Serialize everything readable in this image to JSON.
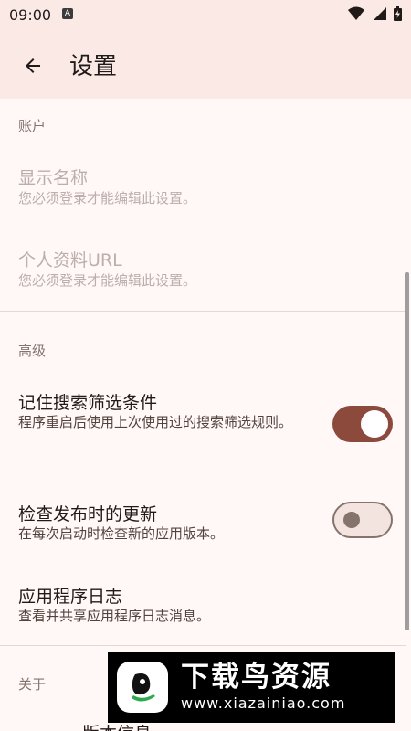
{
  "status_bar": {
    "time": "09:00",
    "badge": "A"
  },
  "app_bar": {
    "title": "设置"
  },
  "sections": {
    "account": {
      "header": "账户",
      "display_name": {
        "title": "显示名称",
        "summary": "您必须登录才能编辑此设置。"
      },
      "profile_url": {
        "title": "个人资料URL",
        "summary": "您必须登录才能编辑此设置。"
      }
    },
    "advanced": {
      "header": "高级",
      "remember_filters": {
        "title": "记住搜索筛选条件",
        "summary": "程序重启后使用上次使用过的搜索筛选规则。",
        "enabled": true
      },
      "check_updates": {
        "title": "检查发布时的更新",
        "summary": "在每次启动时检查新的应用版本。",
        "enabled": false
      },
      "app_log": {
        "title": "应用程序日志",
        "summary": "查看并共享应用程序日志消息。"
      }
    },
    "about": {
      "header": "关于",
      "version_info": {
        "title": "版本信息"
      }
    }
  },
  "watermark": {
    "title": "下载鸟资源",
    "url": "www.xiazainiao.com"
  },
  "colors": {
    "accent": "#8c4a3c",
    "app_bar": "#fbe9e6",
    "background": "#fff8f6"
  }
}
